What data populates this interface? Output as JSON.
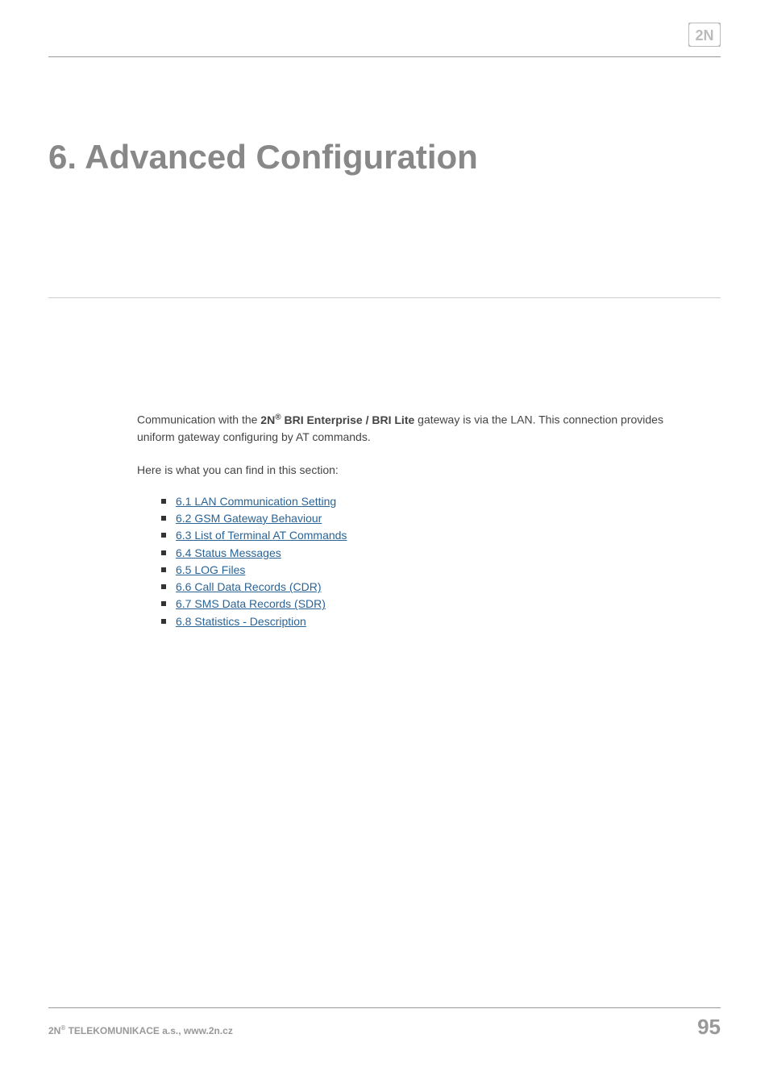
{
  "logo": "2N",
  "heading": "6. Advanced Configuration",
  "intro": {
    "prefix": "Communication with the ",
    "brand_prefix": "2N",
    "brand_sup": "®",
    "brand_suffix": " BRI Enterprise / BRI Lite",
    "suffix": " gateway is via the LAN. This connection provides uniform gateway configuring by AT commands."
  },
  "section_prompt": "Here is what you can find in this section:",
  "links": [
    "6.1 LAN Communication Setting",
    "6.2 GSM Gateway Behaviour",
    "6.3 List of Terminal AT Commands",
    "6.4 Status Messages",
    "6.5 LOG Files",
    "6.6 Call Data Records (CDR)",
    "6.7 SMS Data Records (SDR)",
    "6.8 Statistics - Description"
  ],
  "footer": {
    "company_prefix": "2N",
    "company_sup": "®",
    "company_suffix": " TELEKOMUNIKACE a.s., www.2n.cz"
  },
  "page_number": "95"
}
